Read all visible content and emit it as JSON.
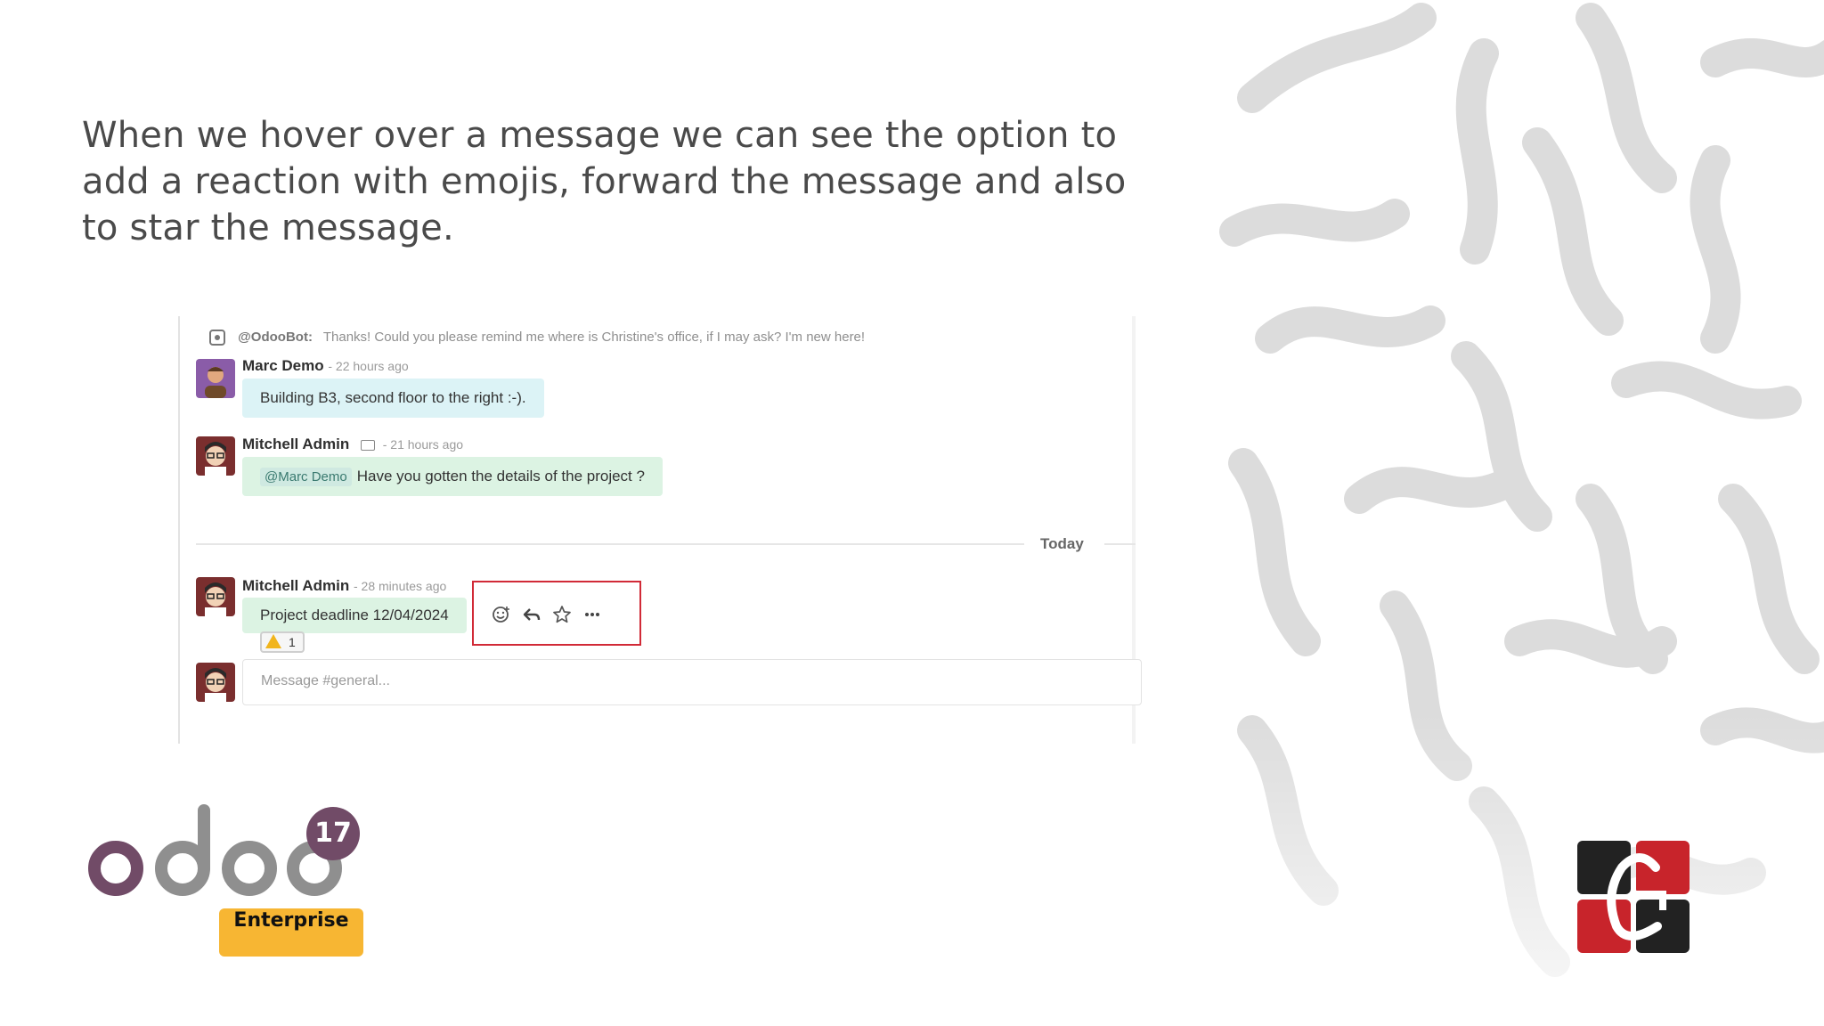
{
  "slide": {
    "caption": "When we hover over a message we can see the option to add a reaction with emojis, forward the message and also to star the message."
  },
  "chat": {
    "bot_line": {
      "name": "@OdooBot:",
      "text": "Thanks! Could you please remind me where is Christine's office, if I may ask? I'm new here!"
    },
    "messages": [
      {
        "author": "Marc Demo",
        "time": "- 22 hours ago",
        "text": "Building B3, second floor to the right :-)."
      },
      {
        "author": "Mitchell Admin",
        "time": "- 21 hours ago",
        "mention": "@Marc Demo",
        "text": "Have you gotten the details of the project ?"
      },
      {
        "author": "Mitchell Admin",
        "time": "- 28 minutes ago",
        "text": "Project deadline 12/04/2024"
      }
    ],
    "separator": "Today",
    "reaction": {
      "emoji": "warning",
      "count": "1"
    },
    "actions": [
      "add-reaction-icon",
      "reply-icon",
      "star-icon",
      "more-icon"
    ],
    "composer_placeholder": "Message #general..."
  },
  "branding": {
    "odoo_version": "17",
    "edition": "Enterprise",
    "colors": {
      "odoo_purple": "#714b67",
      "odoo_grey": "#8f8f8f",
      "edition_badge": "#f7b633",
      "highlight": "#d12a37"
    }
  }
}
